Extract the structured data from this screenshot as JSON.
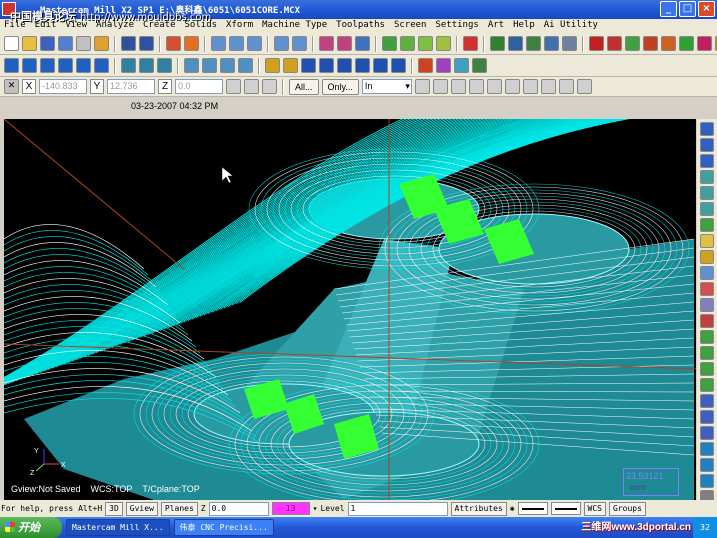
{
  "window": {
    "title": "Mastercam Mill X2 SP1   E:\\奥科鑫\\6051\\6051CORE.MCX",
    "watermark_cn": "中国模具论坛",
    "watermark_url": "http://www.mouldbbs.com",
    "controls": {
      "minimize": "_",
      "maximize": "□",
      "close": "×"
    }
  },
  "menu": [
    "File",
    "Edit",
    "View",
    "Analyze",
    "Create",
    "Solids",
    "Xform",
    "Machine Type",
    "Toolpaths",
    "Screen",
    "Settings",
    "Art",
    "Help",
    "Ai Utility"
  ],
  "coords": {
    "x_label": "X",
    "x_value": "-140.833",
    "y_label": "Y",
    "y_value": "12.736",
    "z_label": "Z",
    "z_value": "0.0",
    "all_button": "All...",
    "only_button": "Only...",
    "filter_select": "In"
  },
  "datestamp": "03-23-2007 04:32 PM",
  "viewport": {
    "gview": "Gview:Not Saved",
    "wcs": "WCS:TOP",
    "tcplane": "T/Cplane:TOP",
    "measure_value": "23.53121",
    "measure_sub": "mm",
    "axes": {
      "y": "Y",
      "x": "X",
      "z": "Z"
    },
    "colors": {
      "background": "#000000",
      "toolpath": "#00e5e5",
      "model": "#2fa0a8",
      "highlight": "#33ff33",
      "outline": "#ffffff"
    }
  },
  "status": {
    "help": "For help, press Alt+H",
    "mode_3d": "3D",
    "gview": "Gview",
    "planes": "Planes",
    "z_label": "Z",
    "z_value": "0.0",
    "color_value": "13",
    "level_label": "Level",
    "level_value": "1",
    "attributes": "Attributes",
    "wcs": "WCS",
    "groups": "Groups"
  },
  "taskbar": {
    "start": "开始",
    "tasks": [
      "Mastercam Mill X...",
      "伟泰 CNC Precisi..."
    ],
    "watermark": "三维网www.3dportal.cn",
    "clock": "32"
  }
}
